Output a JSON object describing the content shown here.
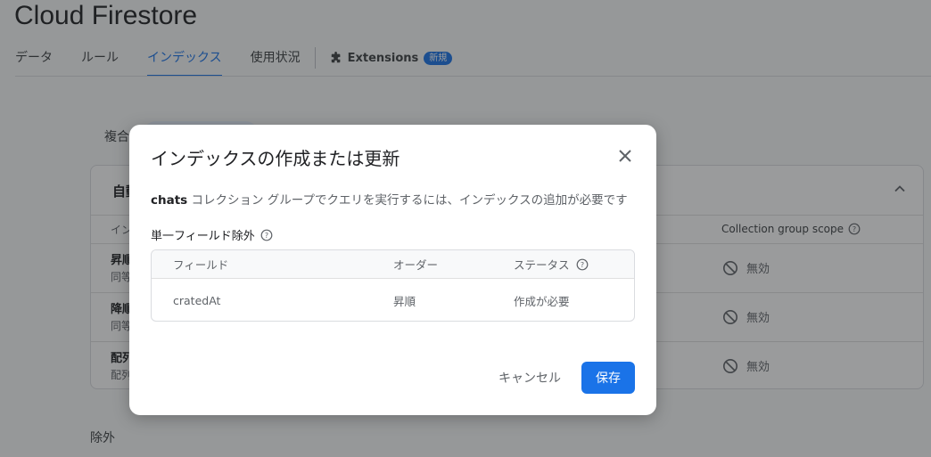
{
  "page": {
    "title": "Cloud Firestore",
    "tabs": [
      "データ",
      "ルール",
      "インデックス",
      "使用状況"
    ],
    "extensions_label": "Extensions",
    "new_badge": "新規",
    "section_composite": "複合",
    "section_exclusions": "除外"
  },
  "card": {
    "heading": "自動",
    "column_header_left": "イン",
    "column_header_scope": "Collection group scope",
    "rows": [
      {
        "name": "昇順",
        "sub": "同等",
        "scope": "無効"
      },
      {
        "name": "降順",
        "sub": "同等",
        "scope": "無効"
      },
      {
        "name": "配列",
        "sub": "配列",
        "scope": "無効"
      }
    ]
  },
  "dialog": {
    "title": "インデックスの作成または更新",
    "description_bold": "chats",
    "description_rest": " コレクション グループでクエリを実行するには、インデックスの追加が必要です",
    "section_title": "単一フィールド除外",
    "table": {
      "headers": [
        "フィールド",
        "オーダー",
        "ステータス"
      ],
      "rows": [
        {
          "field": "cratedAt",
          "order": "昇順",
          "status": "作成が必要"
        }
      ]
    },
    "cancel_label": "キャンセル",
    "save_label": "保存"
  },
  "colors": {
    "accent": "#1a73e8",
    "scrim": "rgba(32,33,36,0.45)"
  }
}
